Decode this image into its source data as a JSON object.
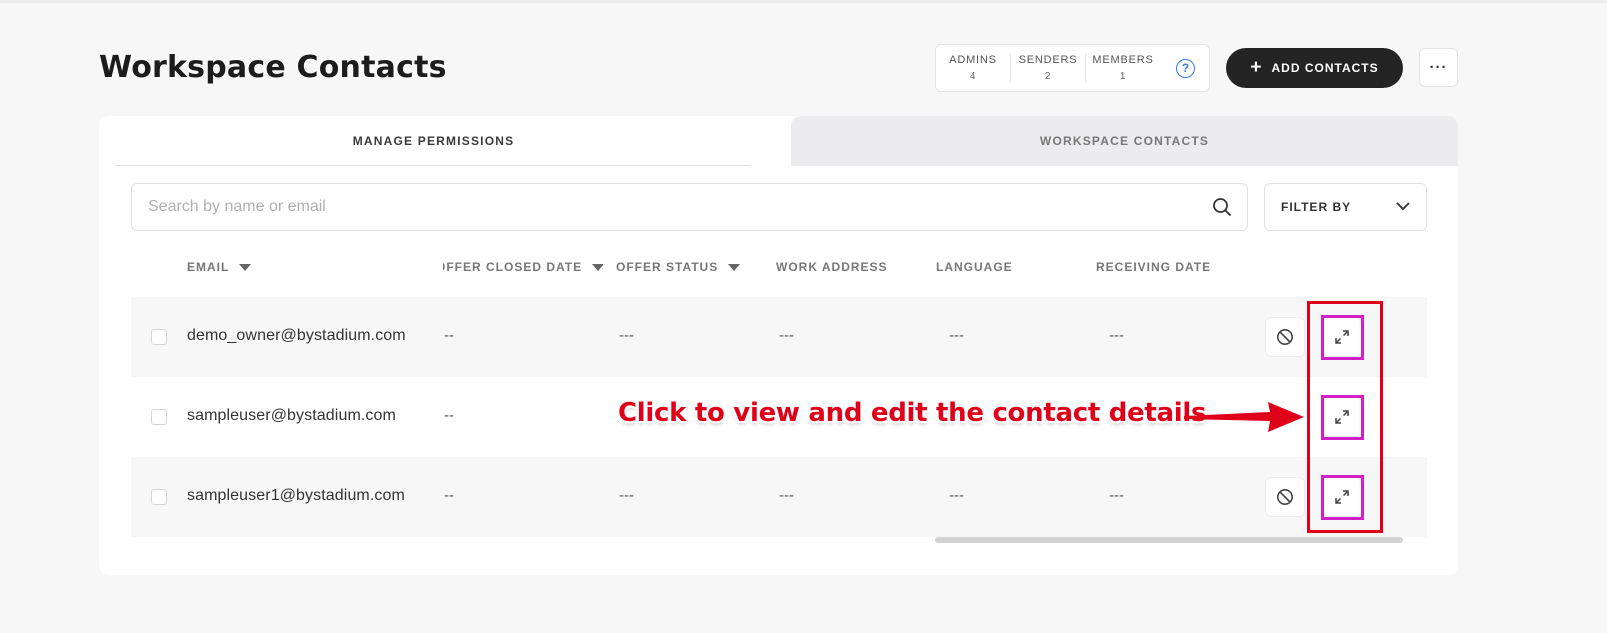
{
  "page": {
    "title": "Workspace Contacts"
  },
  "stats": [
    {
      "label": "ADMINS",
      "value": "4"
    },
    {
      "label": "SENDERS",
      "value": "2"
    },
    {
      "label": "MEMBERS",
      "value": "1"
    }
  ],
  "help_icon": "?",
  "toolbar": {
    "add_contacts_label": "ADD CONTACTS",
    "add_icon": "+",
    "more_label": "···"
  },
  "tabs": [
    {
      "label": "MANAGE PERMISSIONS",
      "active": true
    },
    {
      "label": "WORKSPACE CONTACTS",
      "active": false
    }
  ],
  "search": {
    "placeholder": "Search by name or email",
    "value": ""
  },
  "filter": {
    "label": "FILTER BY"
  },
  "table": {
    "columns": [
      {
        "label": "EMAIL",
        "sortable": true
      },
      {
        "label": "OFFER CLOSED DATE",
        "sortable": true
      },
      {
        "label": "OFFER STATUS",
        "sortable": true
      },
      {
        "label": "WORK ADDRESS",
        "sortable": false
      },
      {
        "label": "LANGUAGE",
        "sortable": false
      },
      {
        "label": "RECEIVING DATE",
        "sortable": false
      }
    ],
    "rows": [
      {
        "email": "demo_owner@bystadium.com",
        "offer_closed_date": "--",
        "offer_status": "---",
        "work_address": "---",
        "language": "---",
        "receiving_date": "---"
      },
      {
        "email": "sampleuser@bystadium.com",
        "offer_closed_date": "--",
        "offer_status": "---",
        "work_address": "---",
        "language": "---",
        "receiving_date": "---"
      },
      {
        "email": "sampleuser1@bystadium.com",
        "offer_closed_date": "--",
        "offer_status": "---",
        "work_address": "---",
        "language": "---",
        "receiving_date": "---"
      }
    ]
  },
  "annotation": {
    "text": "Click to view and edit the contact details",
    "color": "#e0001a",
    "highlight_color": "#d21fc8"
  },
  "icons": {
    "search": "search-icon",
    "chevron": "chevron-down-icon",
    "block": "block-icon",
    "expand": "expand-icon"
  }
}
